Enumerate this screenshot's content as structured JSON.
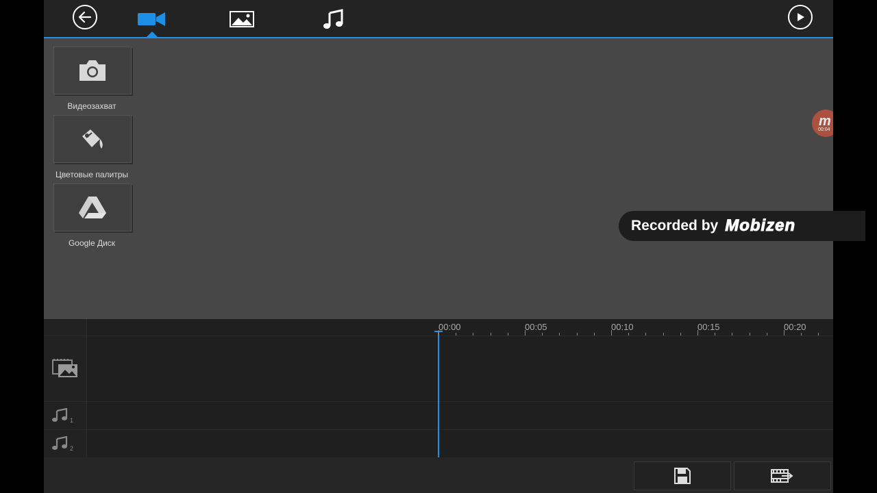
{
  "topbar": {
    "back_icon": "arrow-left-icon",
    "tabs": [
      {
        "name": "video",
        "icon": "video-camera-icon",
        "active": true
      },
      {
        "name": "image",
        "icon": "image-icon",
        "active": false
      },
      {
        "name": "music",
        "icon": "music-note-icon",
        "active": false
      }
    ],
    "play_icon": "play-icon",
    "accent_color": "#1d8fe6"
  },
  "media_panel": {
    "items": [
      {
        "label": "Видеозахват",
        "icon": "camera-icon"
      },
      {
        "label": "Цветовые палитры",
        "icon": "paint-bucket-icon"
      },
      {
        "label": "Google Диск",
        "icon": "google-drive-icon"
      }
    ]
  },
  "overlay": {
    "bubble_letter": "m",
    "bubble_time": "00:04",
    "recorded_text": "Recorded by",
    "brand": "Mobizen"
  },
  "timeline": {
    "ticks": [
      "00:00",
      "00:05",
      "00:10",
      "00:15",
      "00:20"
    ],
    "track_icons": [
      "film-image-icon",
      "music-track-1-icon",
      "music-track-2-icon"
    ],
    "track_numbers": [
      "1",
      "2"
    ]
  },
  "bottombar": {
    "buttons": [
      {
        "name": "save",
        "icon": "save-icon"
      },
      {
        "name": "export",
        "icon": "export-film-icon"
      }
    ]
  }
}
